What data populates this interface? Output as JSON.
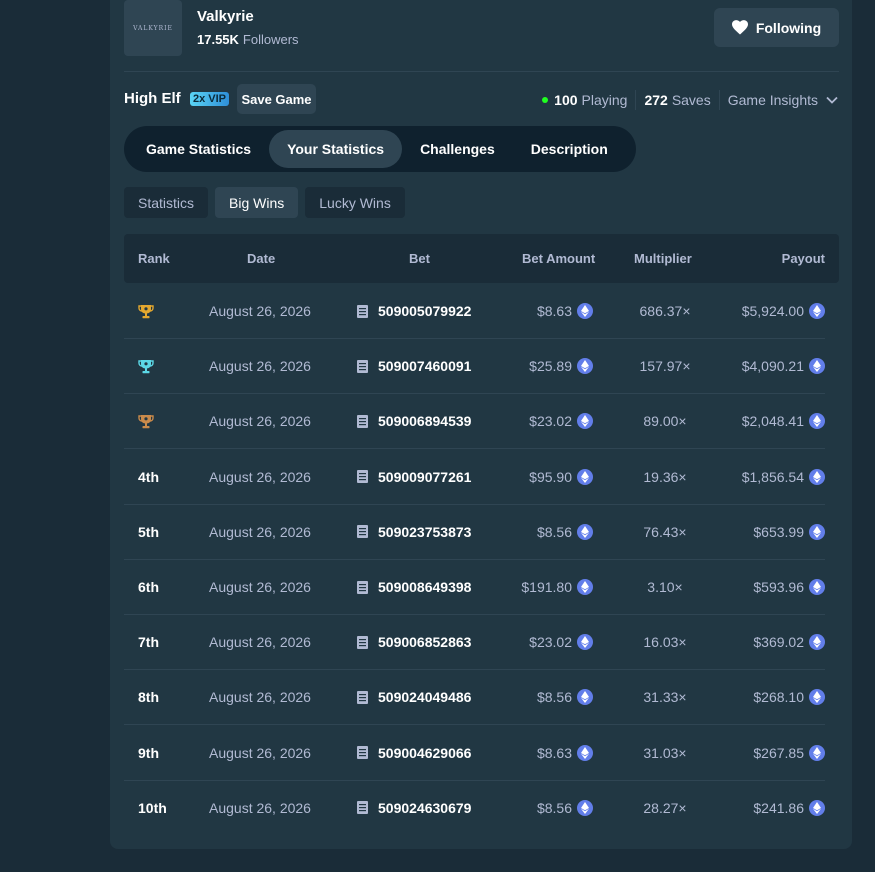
{
  "provider": {
    "logo_text": "VALKYRIE",
    "name": "Valkyrie",
    "followers_count": "17.55K",
    "followers_label": "Followers",
    "follow_label": "Following"
  },
  "game": {
    "name": "High Elf",
    "vip_badge": "2x VIP",
    "save_label": "Save Game",
    "playing_count": "100",
    "playing_label": "Playing",
    "saves_count": "272",
    "saves_label": "Saves",
    "insights_label": "Game Insights"
  },
  "tabs": [
    {
      "label": "Game Statistics",
      "active": false
    },
    {
      "label": "Your Statistics",
      "active": true
    },
    {
      "label": "Challenges",
      "active": false
    },
    {
      "label": "Description",
      "active": false
    }
  ],
  "subtabs": [
    {
      "label": "Statistics",
      "active": false
    },
    {
      "label": "Big Wins",
      "active": true
    },
    {
      "label": "Lucky Wins",
      "active": false
    }
  ],
  "table": {
    "headers": {
      "rank": "Rank",
      "date": "Date",
      "bet": "Bet",
      "amount": "Bet Amount",
      "multiplier": "Multiplier",
      "payout": "Payout"
    },
    "rows": [
      {
        "rank": "",
        "trophy": "gold",
        "date": "August 26, 2026",
        "bet": "509005079922",
        "amount": "$8.63",
        "multiplier": "686.37×",
        "payout": "$5,924.00"
      },
      {
        "rank": "",
        "trophy": "silver",
        "date": "August 26, 2026",
        "bet": "509007460091",
        "amount": "$25.89",
        "multiplier": "157.97×",
        "payout": "$4,090.21"
      },
      {
        "rank": "",
        "trophy": "bronze",
        "date": "August 26, 2026",
        "bet": "509006894539",
        "amount": "$23.02",
        "multiplier": "89.00×",
        "payout": "$2,048.41"
      },
      {
        "rank": "4th",
        "date": "August 26, 2026",
        "bet": "509009077261",
        "amount": "$95.90",
        "multiplier": "19.36×",
        "payout": "$1,856.54"
      },
      {
        "rank": "5th",
        "date": "August 26, 2026",
        "bet": "509023753873",
        "amount": "$8.56",
        "multiplier": "76.43×",
        "payout": "$653.99"
      },
      {
        "rank": "6th",
        "date": "August 26, 2026",
        "bet": "509008649398",
        "amount": "$191.80",
        "multiplier": "3.10×",
        "payout": "$593.96"
      },
      {
        "rank": "7th",
        "date": "August 26, 2026",
        "bet": "509006852863",
        "amount": "$23.02",
        "multiplier": "16.03×",
        "payout": "$369.02"
      },
      {
        "rank": "8th",
        "date": "August 26, 2026",
        "bet": "509024049486",
        "amount": "$8.56",
        "multiplier": "31.33×",
        "payout": "$268.10"
      },
      {
        "rank": "9th",
        "date": "August 26, 2026",
        "bet": "509004629066",
        "amount": "$8.63",
        "multiplier": "31.03×",
        "payout": "$267.85"
      },
      {
        "rank": "10th",
        "date": "August 26, 2026",
        "bet": "509024630679",
        "amount": "$8.56",
        "multiplier": "28.27×",
        "payout": "$241.86"
      }
    ]
  },
  "colors": {
    "background": "#1a2c38",
    "panel": "#213743",
    "button": "#2f4553",
    "muted_text": "#b1bad3",
    "online_dot": "#1fff20",
    "eth": "#627eea",
    "trophy_gold": "#e3a72f",
    "trophy_silver": "#5cd8e6",
    "trophy_bronze": "#c98a4b"
  }
}
